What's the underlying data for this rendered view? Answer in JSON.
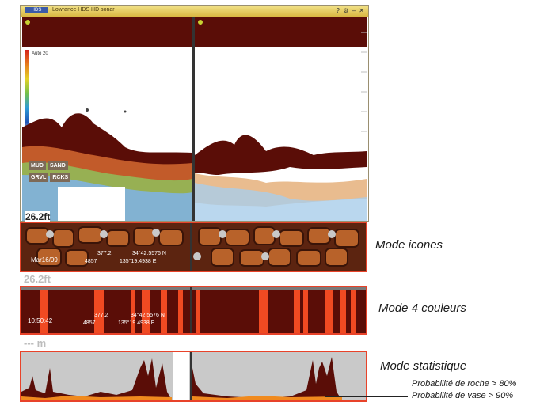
{
  "window": {
    "title": "Lowrance HDS HD sonar",
    "logo": "HDS",
    "controls": "? ⚙ – ✕"
  },
  "sonar": {
    "depth_left": "26.2ft",
    "depth_right": "",
    "top_scale": "Auto 20",
    "legend": [
      "MUD",
      "SAND",
      "GRVL",
      "RCKS"
    ]
  },
  "strip1": {
    "date": "Mar16/09",
    "val1": "377.2",
    "val2": "4857",
    "lat": "34°42.5576 N",
    "lon": "135°19.4938 E"
  },
  "strip2": {
    "ghost_depth": "26.2ft",
    "time": "10:50:42",
    "val1": "377.2",
    "val2": "4857",
    "lat": "34°42.5576 N",
    "lon": "135°19.4938 E"
  },
  "strip3": {
    "ghost_depth": "--- m"
  },
  "labels": {
    "mode_icons": "Mode icones",
    "mode_4col": "Mode 4 couleurs",
    "mode_stat": "Mode statistique",
    "prob_rock": "Probabilité de roche > 80%",
    "prob_mud": "Probabilité de vase > 90%"
  },
  "colors": {
    "maroon": "#5a0d07",
    "red_orange": "#e8432a",
    "bar_red": "#f04a22"
  }
}
